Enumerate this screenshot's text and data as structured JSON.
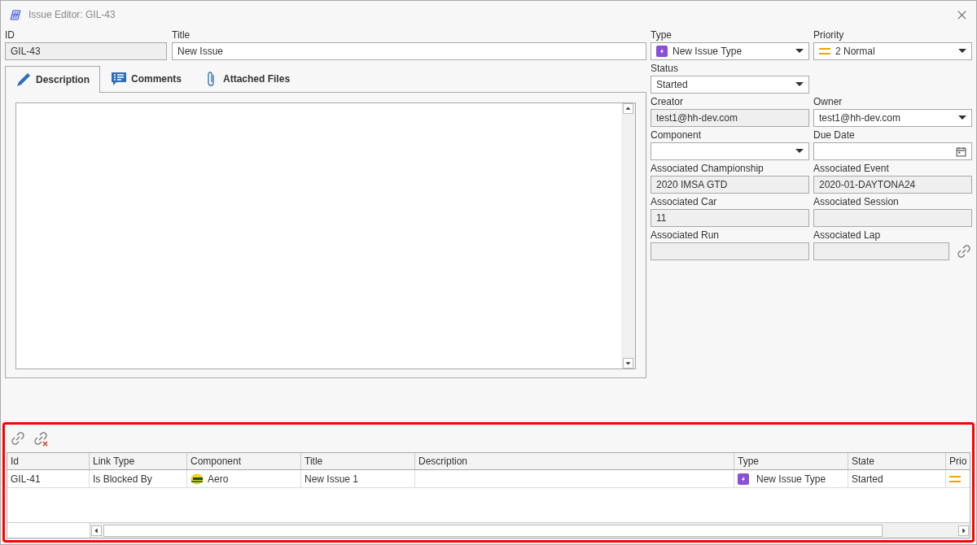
{
  "window": {
    "title": "Issue Editor: GIL-43"
  },
  "id_field": {
    "label": "ID",
    "value": "GIL-43",
    "readonly": true
  },
  "title_field": {
    "label": "Title",
    "value": "New Issue",
    "readonly": false
  },
  "tabs": [
    {
      "label": "Description",
      "selected": true
    },
    {
      "label": "Comments",
      "selected": false
    },
    {
      "label": "Attached Files",
      "selected": false
    }
  ],
  "form_rows": [
    [
      {
        "label": "Type",
        "value": "New Issue Type",
        "kind": "dropdown",
        "readonly": false
      },
      {
        "label": "Priority",
        "value": "2 Normal",
        "kind": "dropdown",
        "readonly": false
      }
    ],
    [
      {
        "label": "Status",
        "value": "Started",
        "kind": "dropdown",
        "readonly": false
      }
    ],
    [
      {
        "label": "Creator",
        "value": "test1@hh-dev.com",
        "kind": "text",
        "readonly": true
      },
      {
        "label": "Owner",
        "value": "test1@hh-dev.com",
        "kind": "dropdown",
        "readonly": false
      }
    ],
    [
      {
        "label": "Component",
        "kind": "dropdown",
        "readonly": false
      },
      {
        "label": "Due Date",
        "kind": "date",
        "readonly": false
      }
    ],
    [
      {
        "label": "Associated Championship",
        "value": "2020 IMSA GTD",
        "kind": "text",
        "readonly": true
      },
      {
        "label": "Associated Event",
        "value": "2020-01-DAYTONA24",
        "kind": "text",
        "readonly": true
      }
    ],
    [
      {
        "label": "Associated Car",
        "value": "11",
        "kind": "text",
        "readonly": true
      },
      {
        "label": "Associated Session",
        "kind": "text",
        "readonly": true
      }
    ],
    [
      {
        "label": "Associated Run",
        "kind": "text",
        "readonly": true
      },
      {
        "label": "Associated Lap",
        "kind": "link",
        "readonly": true
      }
    ]
  ],
  "links_table": {
    "columns": [
      {
        "label": "Id",
        "kind": "text"
      },
      {
        "label": "Link Type",
        "kind": "text"
      },
      {
        "label": "Component",
        "kind": "component"
      },
      {
        "label": "Title",
        "kind": "text"
      },
      {
        "label": "Description",
        "kind": "text"
      },
      {
        "label": "Type",
        "kind": "type"
      },
      {
        "label": "State",
        "kind": "text"
      },
      {
        "label": "Prio",
        "kind": "priority"
      }
    ],
    "rows": [
      [
        "GIL-41",
        "Is Blocked By",
        "Aero",
        "New Issue 1",
        "",
        "New Issue Type",
        "Started",
        ""
      ]
    ]
  }
}
